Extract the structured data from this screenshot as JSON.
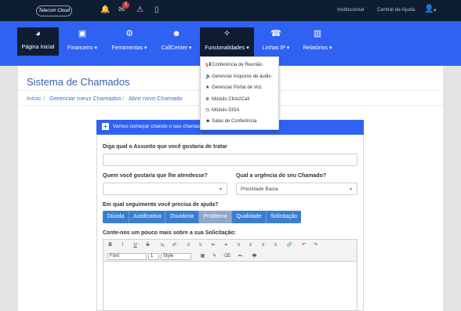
{
  "topbar": {
    "logo_text": "Telecom Cloud",
    "links": [
      "Institucional",
      "Central de Ajuda"
    ],
    "notification_count": "1",
    "user_caret": "▾"
  },
  "navbar": {
    "items": [
      {
        "label": "Página Inicial",
        "icon": "dashboard-icon"
      },
      {
        "label": "Financeiro ▾",
        "icon": "money-icon"
      },
      {
        "label": "Ferramentas ▾",
        "icon": "cogs-icon"
      },
      {
        "label": "CallCenter ▾",
        "icon": "users-icon"
      },
      {
        "label": "Funcionalidades ▾",
        "icon": "magic-wand-icon"
      },
      {
        "label": "Linhas IP ▾",
        "icon": "phone-icon"
      },
      {
        "label": "Relatórios ▾",
        "icon": "bar-chart-icon"
      }
    ]
  },
  "dropdown": {
    "items": [
      {
        "label": "Conferência de Reunião",
        "icon": "bullhorn-icon"
      },
      {
        "label": "Gerenciar Arquivos de áudio",
        "icon": "volume-icon"
      },
      {
        "label": "Gerenciar Portal de Voz",
        "icon": "star-icon"
      },
      {
        "label": "Módulo Click2Call",
        "icon": "crosshair-icon"
      },
      {
        "label": "Módulo DISA",
        "icon": "clock-icon"
      },
      {
        "label": "Salas de Conferência",
        "icon": "users-icon"
      }
    ]
  },
  "page": {
    "title": "Sistema de Chamados",
    "breadcrumb": [
      "Início",
      "Gerenciar meus Chamados",
      "Abrir novo Chamado"
    ],
    "breadcrumb_sep": "/"
  },
  "form": {
    "header": "Vamos começar criando o seu chamado...",
    "subject_label": "Diga qual o Assunto que você gostaria de tratar",
    "subject_value": "",
    "attendant_label": "Quem você gostaria que lhe atendesse?",
    "attendant_value": "",
    "urgency_label": "Qual a urgência do seu Chamado?",
    "urgency_value": "Prioridade Baixa",
    "segment_label": "Em qual seguimento você precisa de ajuda?",
    "segments": [
      "Dúvida",
      "Justificativa",
      "Ouvidoria",
      "Problema",
      "Qualidade",
      "Solicitação"
    ],
    "active_segment": "Problema",
    "details_label": "Conte-nos um pouco mais sobre a sua Solicitação:",
    "editor": {
      "row1": [
        "B",
        "I",
        "U",
        "S",
        "x₂",
        "x²",
        "≡",
        "≡",
        "⇤",
        "⇥",
        "≡",
        "≡",
        "≡",
        "≡",
        "🔗",
        "↶",
        "↷"
      ],
      "font_value": "Font",
      "size_value": "1",
      "style_value": "Style",
      "row2": [
        "▦",
        "✎",
        "⌫",
        "⌗",
        "⇔",
        "🖶"
      ]
    }
  },
  "colors": {
    "topbar": "#0f1d33",
    "navbar": "#2f62f3",
    "accent": "#3a7ed0",
    "title": "#3a5eb0"
  }
}
